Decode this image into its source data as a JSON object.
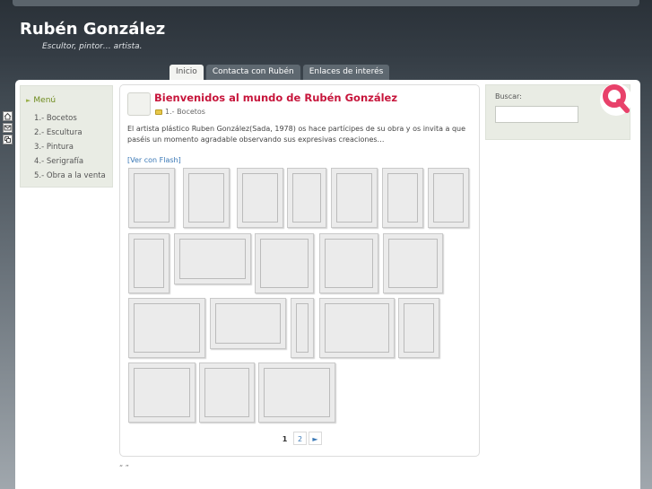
{
  "site": {
    "title": "Rubén González",
    "tagline": "Escultor, pintor… artista."
  },
  "tabs": [
    {
      "label": "Inicio",
      "active": true
    },
    {
      "label": "Contacta con Rubén",
      "active": false
    },
    {
      "label": "Enlaces de interés",
      "active": false
    }
  ],
  "side_icons": [
    "home-icon",
    "mail-icon",
    "bookmark-icon"
  ],
  "menu": {
    "title": "Menú",
    "items": [
      "1.- Bocetos",
      "2.- Escultura",
      "3.- Pintura",
      "4.- Serigrafía",
      "5.- Obra a la venta"
    ]
  },
  "post": {
    "title": "Bienvenidos al mundo de Rubén González",
    "category": "1.- Bocetos",
    "body": "El artista plástico Ruben González(Sada, 1978) os hace partícipes de su obra y os invita a que paséis un momento agradable observando sus expresivas creaciones…",
    "flash_link": "[Ver con Flash]"
  },
  "gallery": {
    "thumbnail_count": 20
  },
  "pagination": {
    "current": "1",
    "next_page": "2",
    "next_arrow": "►"
  },
  "footer_quotes": "“ ”",
  "search": {
    "label": "Buscar:",
    "value": ""
  },
  "colors": {
    "title_red": "#c7163c",
    "menu_green": "#6d8a1c",
    "link_blue": "#3a78b6",
    "sidebar_bg": "#e9ece4"
  }
}
